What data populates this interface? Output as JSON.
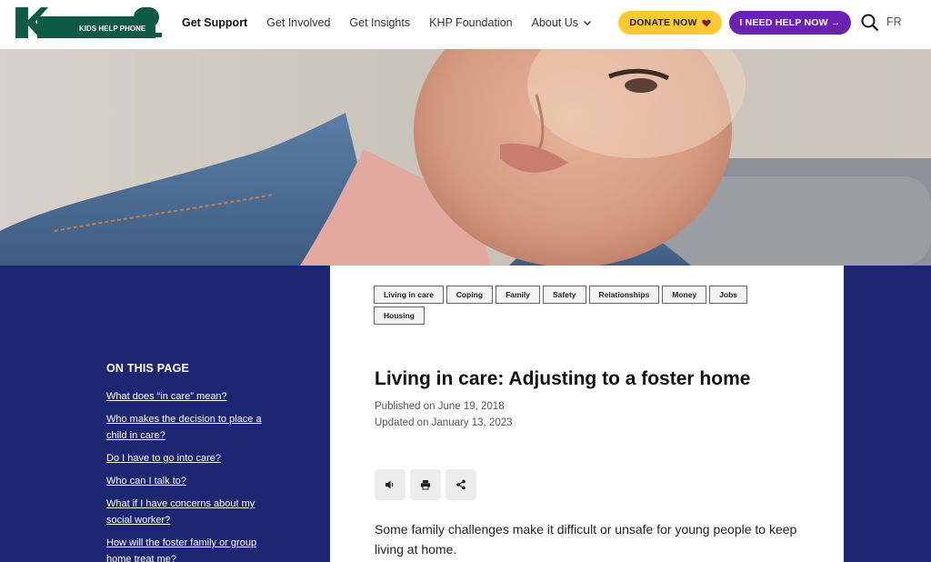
{
  "header": {
    "logo_text": "KIDS HELP PHONE",
    "nav": [
      {
        "label": "Get Support",
        "active": true
      },
      {
        "label": "Get Involved"
      },
      {
        "label": "Get Insights"
      },
      {
        "label": "KHP Foundation"
      },
      {
        "label": "About Us",
        "has_dropdown": true
      }
    ],
    "donate_label": "DONATE NOW",
    "help_label": "I NEED HELP NOW →",
    "lang_label": "FR"
  },
  "toc": {
    "title": "ON THIS PAGE",
    "links": [
      "What does “in care” mean?",
      "Who makes the decision to place a child in care?",
      "Do I have to go into care?",
      "Who can I talk to?",
      "What if I have concerns about my social worker?",
      "How will the foster family or group home treat me?"
    ]
  },
  "article": {
    "tags": [
      "Living in care",
      "Coping",
      "Family",
      "Safety",
      "Relationships",
      "Money",
      "Jobs",
      "Housing"
    ],
    "title": "Living in care: Adjusting to a foster home",
    "published": "Published on June 19, 2018",
    "updated": "Updated on January 13, 2023",
    "intro": "Some family challenges make it difficult or unsafe for young people to keep living at home."
  },
  "colors": {
    "brand_green": "#0e5a47",
    "navy": "#1c2671",
    "donate_yellow": "#ffc933",
    "help_purple": "#6a22b2"
  },
  "icons": [
    "heart-icon",
    "search-icon",
    "chevron-down-icon",
    "speaker-icon",
    "print-icon",
    "share-icon"
  ]
}
